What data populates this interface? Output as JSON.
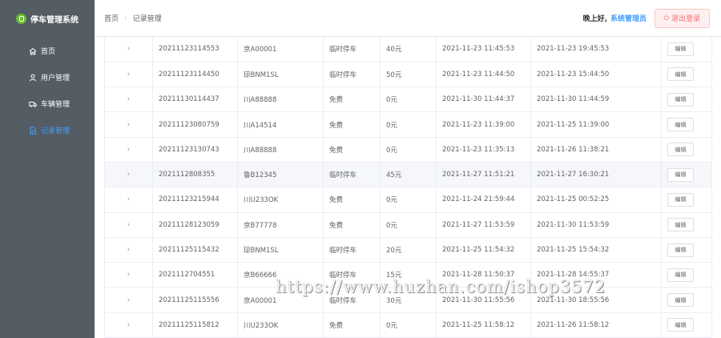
{
  "app": {
    "title": "停车管理系统"
  },
  "sidebar": {
    "items": [
      {
        "label": "首页",
        "icon": "home-icon"
      },
      {
        "label": "用户管理",
        "icon": "user-icon"
      },
      {
        "label": "车辆管理",
        "icon": "truck-icon"
      },
      {
        "label": "记录管理",
        "icon": "document-icon",
        "active": true
      }
    ]
  },
  "header": {
    "breadcrumb": [
      "首页",
      "记录管理"
    ],
    "greeting": "晚上好,",
    "username": "系统管理员",
    "logout_label": "退出登录"
  },
  "table": {
    "edit_label": "编辑",
    "rows": [
      {
        "id": "20211123114553",
        "plate": "京A00001",
        "type": "临时停车",
        "fee": "40元",
        "in_time": "2021-11-23 11:45:53",
        "out_time": "2021-11-23 19:45:53"
      },
      {
        "id": "20211123114450",
        "plate": "琼BNM1SL",
        "type": "临时停车",
        "fee": "50元",
        "in_time": "2021-11-23 11:44:50",
        "out_time": "2021-11-23 15:44:50"
      },
      {
        "id": "20211130114437",
        "plate": "川A88888",
        "type": "免费",
        "fee": "0元",
        "in_time": "2021-11-30 11:44:37",
        "out_time": "2021-11-30 11:44:59"
      },
      {
        "id": "20211123080759",
        "plate": "川A14514",
        "type": "免费",
        "fee": "0元",
        "in_time": "2021-11-23 11:39:00",
        "out_time": "2021-11-25 11:39:00"
      },
      {
        "id": "20211123130743",
        "plate": "川A88888",
        "type": "免费",
        "fee": "0元",
        "in_time": "2021-11-23 11:35:13",
        "out_time": "2021-11-26 11:38:21"
      },
      {
        "id": "2021112808355",
        "plate": "鲁B12345",
        "type": "临时停车",
        "fee": "45元",
        "in_time": "2021-11-27 11:51:21",
        "out_time": "2021-11-27 16:30:21",
        "hover": true
      },
      {
        "id": "20211123215944",
        "plate": "川U233OK",
        "type": "免费",
        "fee": "0元",
        "in_time": "2021-11-24 21:59:44",
        "out_time": "2021-11-25 00:52:25"
      },
      {
        "id": "20211128123059",
        "plate": "京B77778",
        "type": "免费",
        "fee": "0元",
        "in_time": "2021-11-27 11:53:59",
        "out_time": "2021-11-30 11:53:59"
      },
      {
        "id": "20211125115432",
        "plate": "琼BNM1SL",
        "type": "临时停车",
        "fee": "20元",
        "in_time": "2021-11-25 11:54:32",
        "out_time": "2021-11-25 15:54:32"
      },
      {
        "id": "2021112704551",
        "plate": "京B66666",
        "type": "临时停车",
        "fee": "15元",
        "in_time": "2021-11-28 11:50:37",
        "out_time": "2021-11-28 14:55:37"
      },
      {
        "id": "20211125115556",
        "plate": "京A00001",
        "type": "临时停车",
        "fee": "30元",
        "in_time": "2021-11-30 11:55:56",
        "out_time": "2021-11-30 18:55:56"
      },
      {
        "id": "20211125115812",
        "plate": "川U233OK",
        "type": "免费",
        "fee": "0元",
        "in_time": "2021-11-25 11:58:12",
        "out_time": "2021-11-26 11:58:12"
      }
    ]
  },
  "watermark": "https://www.huzhan.com/ishop3572"
}
